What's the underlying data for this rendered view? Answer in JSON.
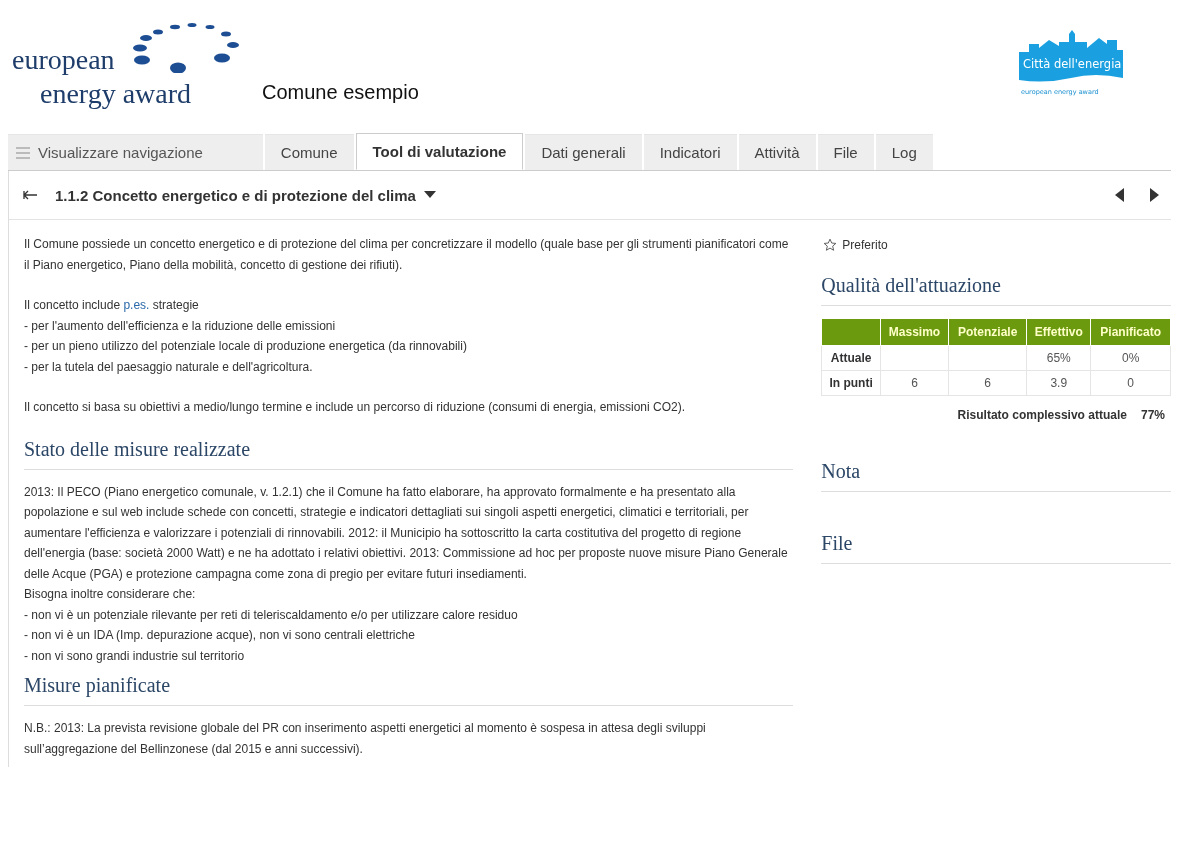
{
  "header": {
    "logo_lines": [
      "european",
      "energy award"
    ],
    "municipality": "Comune esempio",
    "badge": {
      "title": "Città dell'energia",
      "subtitle": "european energy award"
    }
  },
  "nav": {
    "toggle": "Visualizzare navigazione",
    "tabs": [
      {
        "label": "Comune",
        "selected": false
      },
      {
        "label": "Tool di valutazione",
        "selected": true
      },
      {
        "label": "Dati generali",
        "selected": false
      },
      {
        "label": "Indicatori",
        "selected": false
      },
      {
        "label": "Attività",
        "selected": false
      },
      {
        "label": "File",
        "selected": false
      },
      {
        "label": "Log",
        "selected": false
      }
    ]
  },
  "measure": {
    "title": "1.1.2 Concetto energetico e di protezione del clima"
  },
  "description": [
    {
      "lines": [
        {
          "text": "Il Comune possiede un concetto energetico e di protezione del clima per concretizzare il modello (quale base per gli strumenti pianificatori come il Piano energetico, Piano della mobilità, concetto di gestione dei rifiuti)."
        }
      ]
    },
    {
      "lines": [
        {
          "text": "Il concetto include ",
          "link": "p.es.",
          "after": " strategie"
        },
        {
          "text": "- per l'aumento dell'efficienza e la riduzione delle emissioni"
        },
        {
          "text": "- per un pieno utilizzo del potenziale locale di produzione energetica (da rinnovabili)"
        },
        {
          "text": "- per la tutela del paesaggio naturale e dell'agricoltura."
        }
      ]
    },
    {
      "lines": [
        {
          "text": "Il concetto si basa su obiettivi a medio/lungo termine e include un percorso di riduzione (consumi di energia, emissioni CO2)."
        }
      ]
    }
  ],
  "sections": [
    {
      "heading": "Stato delle misure realizzate",
      "lines": [
        "2013: Il PECO (Piano energetico comunale, v. 1.2.1) che il Comune ha fatto elaborare, ha approvato formalmente e ha presentato alla popolazione e sul web include schede con concetti, strategie e indicatori dettagliati sui singoli aspetti energetici, climatici e territoriali, per aumentare l'efficienza e valorizzare i potenziali di rinnovabili. 2012: il Municipio ha sottoscritto la carta costitutiva del progetto di regione dell'energia (base: società 2000 Watt) e ne ha adottato i relativi obiettivi. 2013: Commissione ad hoc per proposte nuove misure Piano Generale delle Acque (PGA) e protezione campagna come zona di pregio per evitare futuri insediamenti.",
        "Bisogna inoltre considerare che:",
        "- non vi è un potenziale rilevante per reti di teleriscaldamento e/o per utilizzare calore residuo",
        "- non vi è un IDA (Imp. depurazione acque), non vi sono centrali elettriche",
        "- non vi sono grandi industrie sul territorio"
      ]
    },
    {
      "heading": "Misure pianificate",
      "lines": [
        "N.B.: 2013: La prevista revisione globale del PR con inserimento aspetti energetici al momento è sospesa in attesa degli sviluppi sull’aggregazione del Bellinzonese (dal 2015 e anni successivi)."
      ]
    }
  ],
  "sidebar": {
    "favorite": {
      "label": "Preferito",
      "starred": false
    },
    "quality": {
      "heading": "Qualità dell'attuazione",
      "columns": [
        "Massimo",
        "Potenziale",
        "Effettivo",
        "Pianificato"
      ],
      "rows": [
        {
          "label": "Attuale",
          "cells": [
            null,
            null,
            "65%",
            "0%"
          ]
        },
        {
          "label": "In punti",
          "cells": [
            "6",
            "6",
            "3.9",
            "0"
          ]
        }
      ],
      "total": {
        "label": "Risultato complessivo attuale",
        "value": "77%"
      }
    },
    "panels": [
      {
        "heading": "Nota"
      },
      {
        "heading": "File"
      }
    ]
  }
}
